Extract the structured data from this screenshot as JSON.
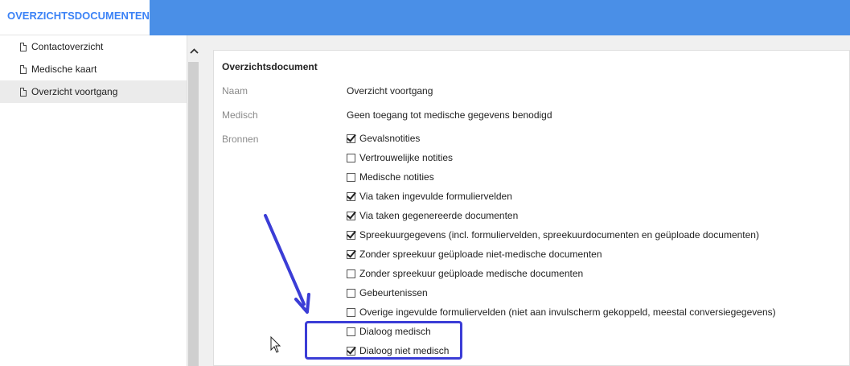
{
  "header": {
    "title": "OVERZICHTSDOCUMENTEN"
  },
  "sidebar": {
    "items": [
      {
        "label": "Contactoverzicht",
        "active": false
      },
      {
        "label": "Medische kaart",
        "active": false
      },
      {
        "label": "Overzicht voortgang",
        "active": true
      }
    ]
  },
  "panel": {
    "title": "Overzichtsdocument",
    "fields": {
      "naam_label": "Naam",
      "naam_value": "Overzicht voortgang",
      "medisch_label": "Medisch",
      "medisch_value": "Geen toegang tot medische gegevens benodigd",
      "bronnen_label": "Bronnen"
    },
    "bronnen": [
      {
        "label": "Gevalsnotities",
        "checked": true
      },
      {
        "label": "Vertrouwelijke notities",
        "checked": false
      },
      {
        "label": "Medische notities",
        "checked": false
      },
      {
        "label": "Via taken ingevulde formuliervelden",
        "checked": true
      },
      {
        "label": "Via taken gegenereerde documenten",
        "checked": true
      },
      {
        "label": "Spreekuurgegevens (incl. formuliervelden, spreekuurdocumenten en geüploade documenten)",
        "checked": true
      },
      {
        "label": "Zonder spreekuur geüploade niet-medische documenten",
        "checked": true
      },
      {
        "label": "Zonder spreekuur geüploade medische documenten",
        "checked": false
      },
      {
        "label": "Gebeurtenissen",
        "checked": false
      },
      {
        "label": "Overige ingevulde formuliervelden (niet aan invulscherm gekoppeld, meestal conversiegegevens)",
        "checked": false
      },
      {
        "label": "Dialoog medisch",
        "checked": false
      },
      {
        "label": "Dialoog niet medisch",
        "checked": true
      }
    ]
  },
  "colors": {
    "accent": "#4a8fe7",
    "header_text": "#3b82f6",
    "highlight": "#3b3dd6"
  },
  "icons": {
    "document": "document-icon",
    "scroll_up": "chevron-up-icon",
    "cursor": "mouse-pointer-icon",
    "annotation": "arrow-annotation"
  }
}
